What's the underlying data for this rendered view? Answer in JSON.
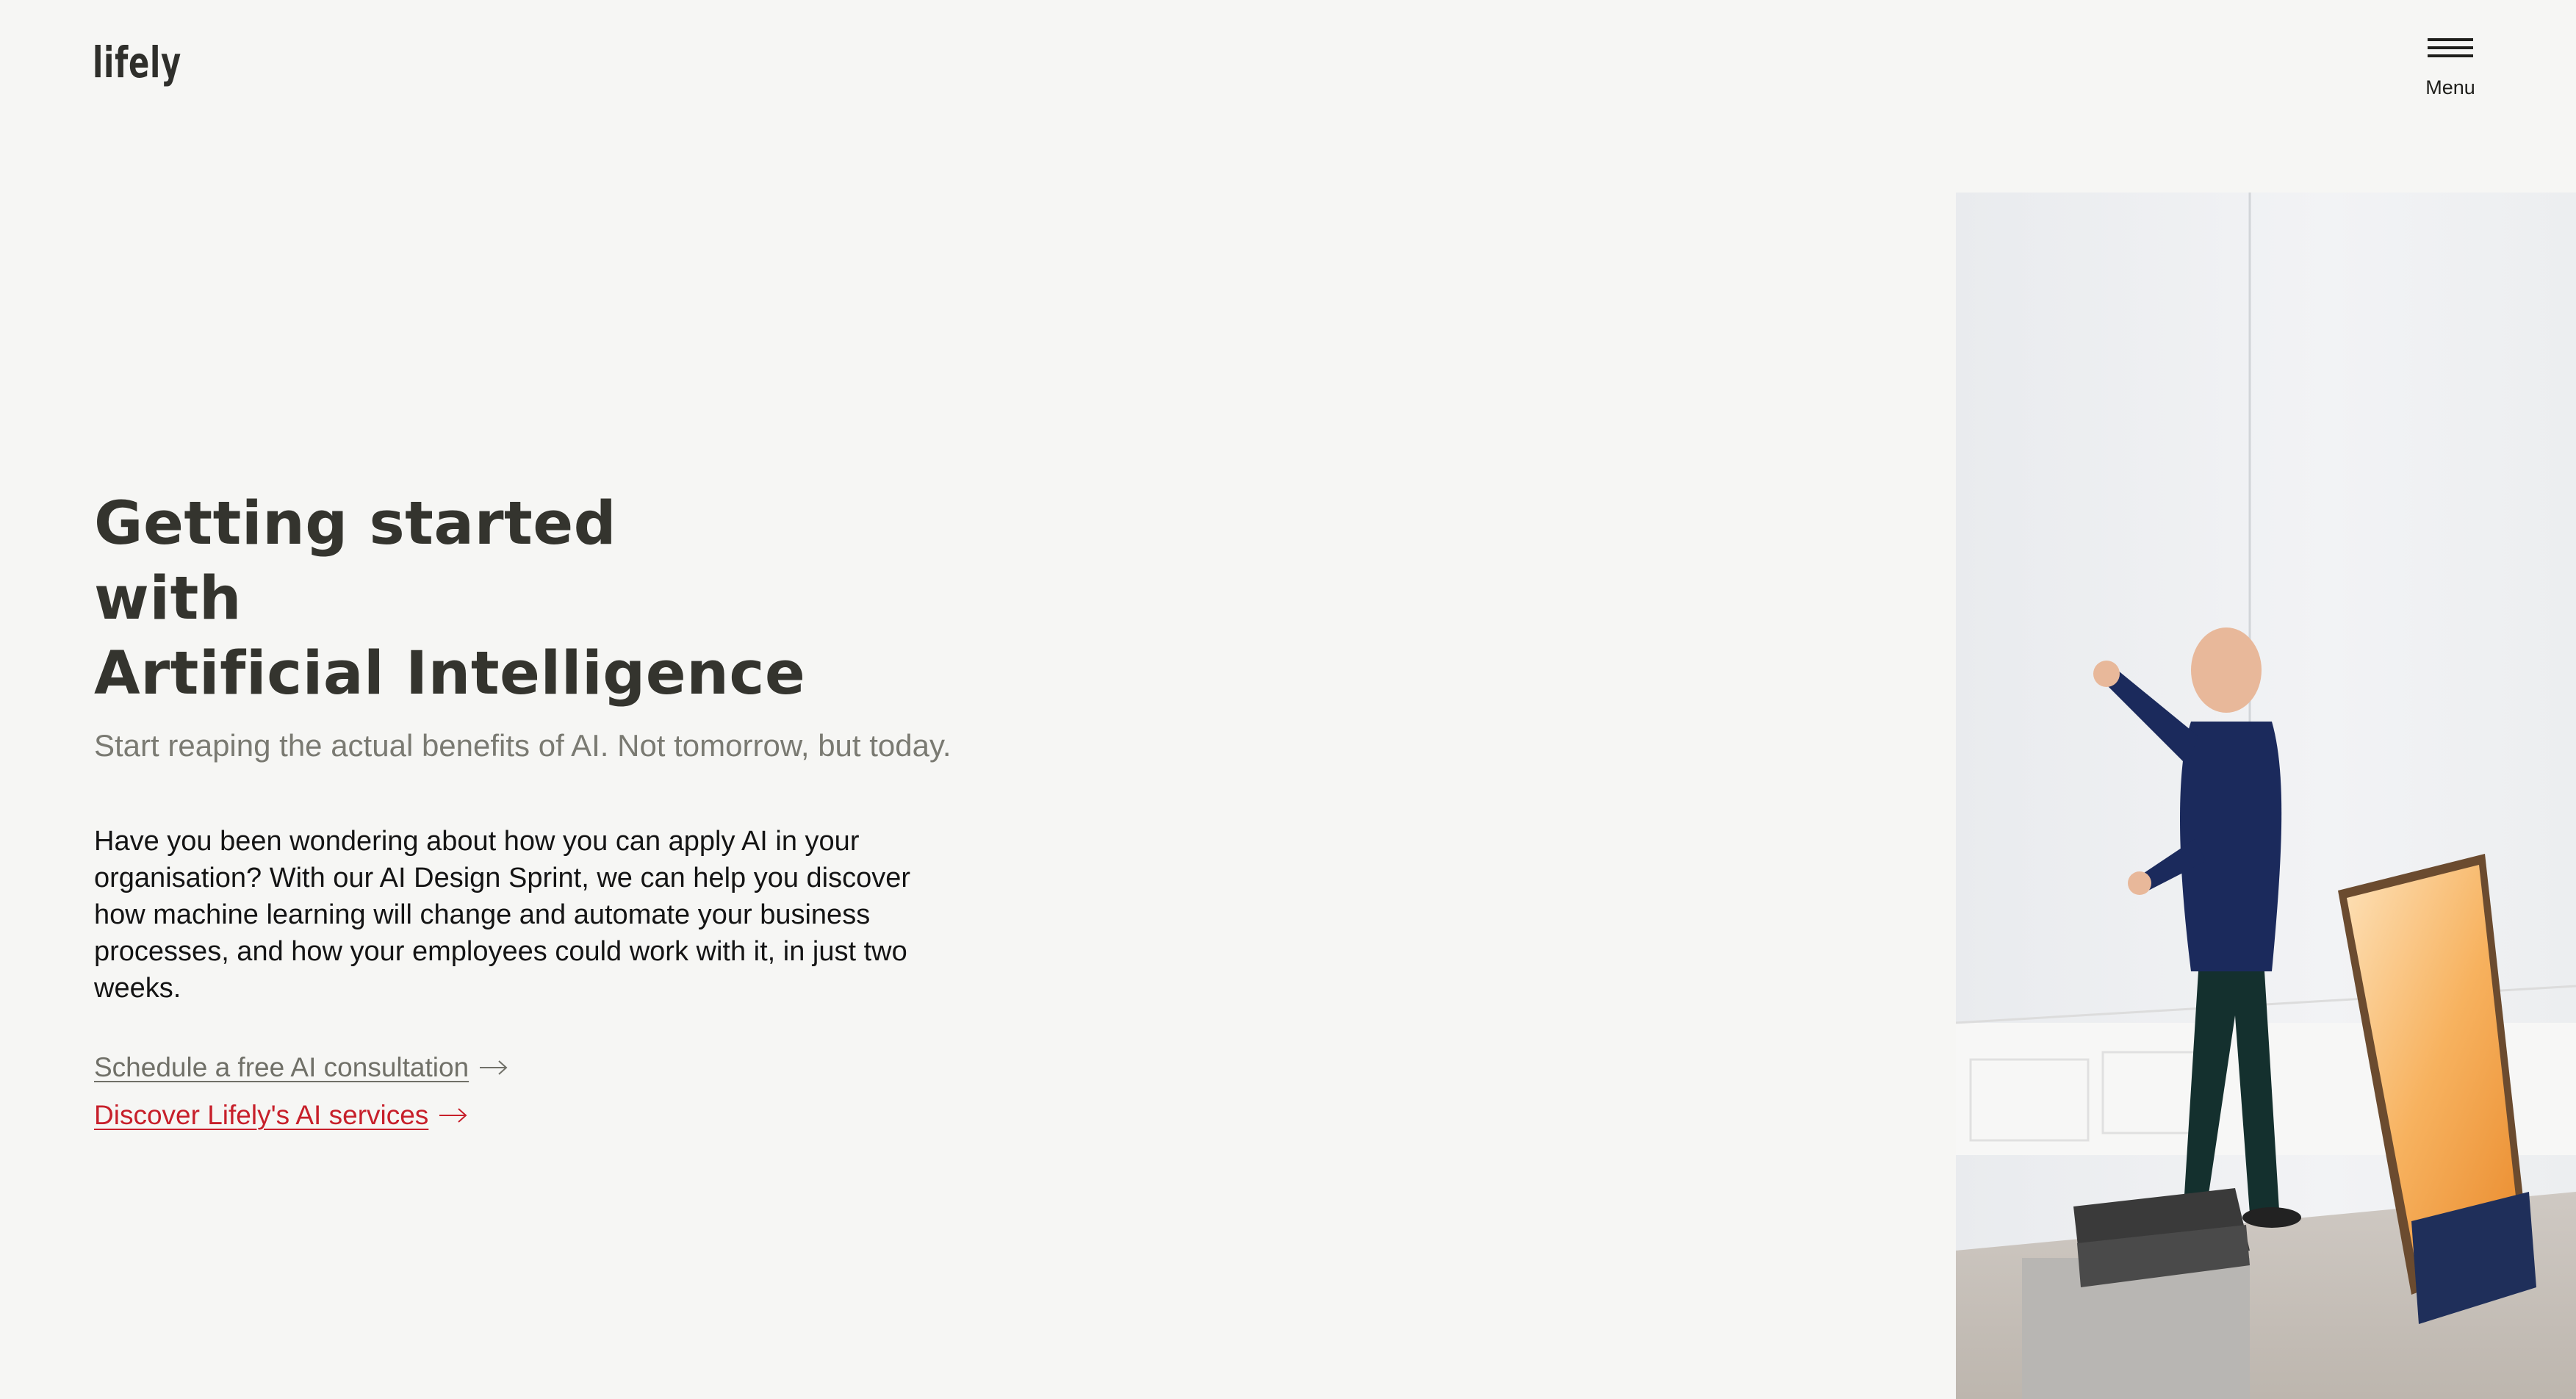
{
  "header": {
    "logo_text": "lifely",
    "menu_label": "Menu"
  },
  "hero": {
    "title_lines": [
      "Getting started",
      "with",
      "Artificial Intelligence"
    ],
    "subtitle": "Start reaping the actual benefits of AI. Not tomorrow, but today.",
    "body": "Have you been wondering about how you can apply AI in your organisation? With our AI Design Sprint, we can help you discover how machine learning will change and automate your business processes, and how your employees could work with it, in just two weeks.",
    "links": [
      {
        "label": "Schedule a free AI consultation",
        "color": "#707068"
      },
      {
        "label": "Discover Lifely's AI services",
        "color": "#c71f2a"
      }
    ]
  },
  "icons": {
    "menu": "hamburger-icon",
    "link_arrow": "arrow-right-icon"
  },
  "colors": {
    "background": "#f6f6f4",
    "heading": "#34342e",
    "subtitle": "#7a7a72",
    "accent": "#c71f2a"
  }
}
